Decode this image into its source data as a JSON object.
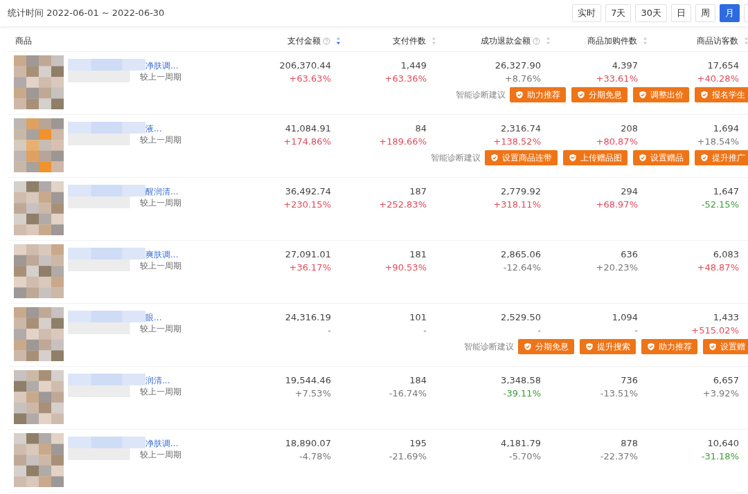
{
  "period": "统计时间 2022-06-01 ~ 2022-06-30",
  "time_buttons": [
    {
      "label": "实时",
      "selected": false
    },
    {
      "label": "7天",
      "selected": false
    },
    {
      "label": "30天",
      "selected": false
    },
    {
      "label": "日",
      "selected": false
    },
    {
      "label": "周",
      "selected": false
    },
    {
      "label": "月",
      "selected": true
    }
  ],
  "columns": [
    {
      "label": "商品",
      "kind": "product"
    },
    {
      "label": "支付金额",
      "kind": "metric",
      "help": true,
      "sorted_desc": true
    },
    {
      "label": "支付件数",
      "kind": "metric",
      "help": false,
      "sorted_desc": false
    },
    {
      "label": "成功退款金额",
      "kind": "metric",
      "help": true,
      "sorted_desc": false
    },
    {
      "label": "商品加购件数",
      "kind": "metric",
      "help": false,
      "sorted_desc": false
    },
    {
      "label": "商品访客数",
      "kind": "metric",
      "help": false,
      "sorted_desc": false
    }
  ],
  "rows": [
    {
      "name": "净肤调...",
      "compare_label": "较上一周期",
      "metrics": [
        {
          "value": "206,370.44",
          "change": "+63.63%",
          "kind": "rise"
        },
        {
          "value": "1,449",
          "change": "+63.36%",
          "kind": "rise"
        },
        {
          "value": "26,327.90",
          "change": "+8.76%",
          "kind": "neutral"
        },
        {
          "value": "4,397",
          "change": "+33.61%",
          "kind": "rise"
        },
        {
          "value": "17,654",
          "change": "+40.28%",
          "kind": "rise"
        }
      ],
      "suggestions": {
        "label": "智能诊断建议",
        "actions": [
          {
            "label": "助力推荐",
            "kind": "shield"
          },
          {
            "label": "分期免息",
            "kind": "shield"
          },
          {
            "label": "调整出价",
            "kind": "shield"
          },
          {
            "label": "报名学生",
            "kind": "shield"
          }
        ]
      }
    },
    {
      "name": "液...",
      "compare_label": "较上一周期",
      "metrics": [
        {
          "value": "41,084.91",
          "change": "+174.86%",
          "kind": "rise"
        },
        {
          "value": "84",
          "change": "+189.66%",
          "kind": "rise"
        },
        {
          "value": "2,316.74",
          "change": "+138.52%",
          "kind": "rise"
        },
        {
          "value": "208",
          "change": "+80.87%",
          "kind": "rise"
        },
        {
          "value": "1,694",
          "change": "+18.54%",
          "kind": "neutral"
        }
      ],
      "suggestions": {
        "label": "智能诊断建议",
        "actions": [
          {
            "label": "设置商品连带",
            "kind": "shield"
          },
          {
            "label": "上传赠品图",
            "kind": "trend"
          },
          {
            "label": "设置赠品",
            "kind": "shield"
          },
          {
            "label": "提升推广",
            "kind": "shield"
          }
        ]
      }
    },
    {
      "name": "醒润清...",
      "compare_label": "较上一周期",
      "metrics": [
        {
          "value": "36,492.74",
          "change": "+230.15%",
          "kind": "rise"
        },
        {
          "value": "187",
          "change": "+252.83%",
          "kind": "rise"
        },
        {
          "value": "2,779.92",
          "change": "+318.11%",
          "kind": "rise"
        },
        {
          "value": "294",
          "change": "+68.97%",
          "kind": "rise"
        },
        {
          "value": "1,647",
          "change": "-52.15%",
          "kind": "fall"
        }
      ]
    },
    {
      "name": "爽肤调...",
      "compare_label": "较上一周期",
      "metrics": [
        {
          "value": "27,091.01",
          "change": "+36.17%",
          "kind": "rise"
        },
        {
          "value": "181",
          "change": "+90.53%",
          "kind": "rise"
        },
        {
          "value": "2,865.06",
          "change": "-12.64%",
          "kind": "neutral"
        },
        {
          "value": "636",
          "change": "+20.23%",
          "kind": "neutral"
        },
        {
          "value": "6,083",
          "change": "+48.87%",
          "kind": "rise"
        }
      ]
    },
    {
      "name": "眼...",
      "compare_label": "较上一周期",
      "metrics": [
        {
          "value": "24,316.19",
          "change": "-",
          "kind": "neutral"
        },
        {
          "value": "101",
          "change": "-",
          "kind": "neutral"
        },
        {
          "value": "2,529.50",
          "change": "-",
          "kind": "neutral"
        },
        {
          "value": "1,094",
          "change": "-",
          "kind": "neutral"
        },
        {
          "value": "1,433",
          "change": "+515.02%",
          "kind": "rise"
        }
      ],
      "suggestions": {
        "label": "智能诊断建议",
        "actions": [
          {
            "label": "分期免息",
            "kind": "shield"
          },
          {
            "label": "提升搜索",
            "kind": "trend"
          },
          {
            "label": "助力推荐",
            "kind": "shield"
          },
          {
            "label": "设置赠",
            "kind": "shield"
          }
        ]
      }
    },
    {
      "name": "润清...",
      "compare_label": "较上一周期",
      "metrics": [
        {
          "value": "19,544.46",
          "change": "+7.53%",
          "kind": "neutral"
        },
        {
          "value": "184",
          "change": "-16.74%",
          "kind": "neutral"
        },
        {
          "value": "3,348.58",
          "change": "-39.11%",
          "kind": "fall"
        },
        {
          "value": "736",
          "change": "-13.51%",
          "kind": "neutral"
        },
        {
          "value": "6,657",
          "change": "+3.92%",
          "kind": "neutral"
        }
      ]
    },
    {
      "name": "净肤调...",
      "compare_label": "较上一周期",
      "metrics": [
        {
          "value": "18,890.07",
          "change": "-4.78%",
          "kind": "neutral"
        },
        {
          "value": "195",
          "change": "-21.69%",
          "kind": "neutral"
        },
        {
          "value": "4,181.79",
          "change": "-5.70%",
          "kind": "neutral"
        },
        {
          "value": "878",
          "change": "-22.37%",
          "kind": "neutral"
        },
        {
          "value": "10,640",
          "change": "-31.18%",
          "kind": "fall"
        }
      ]
    }
  ]
}
